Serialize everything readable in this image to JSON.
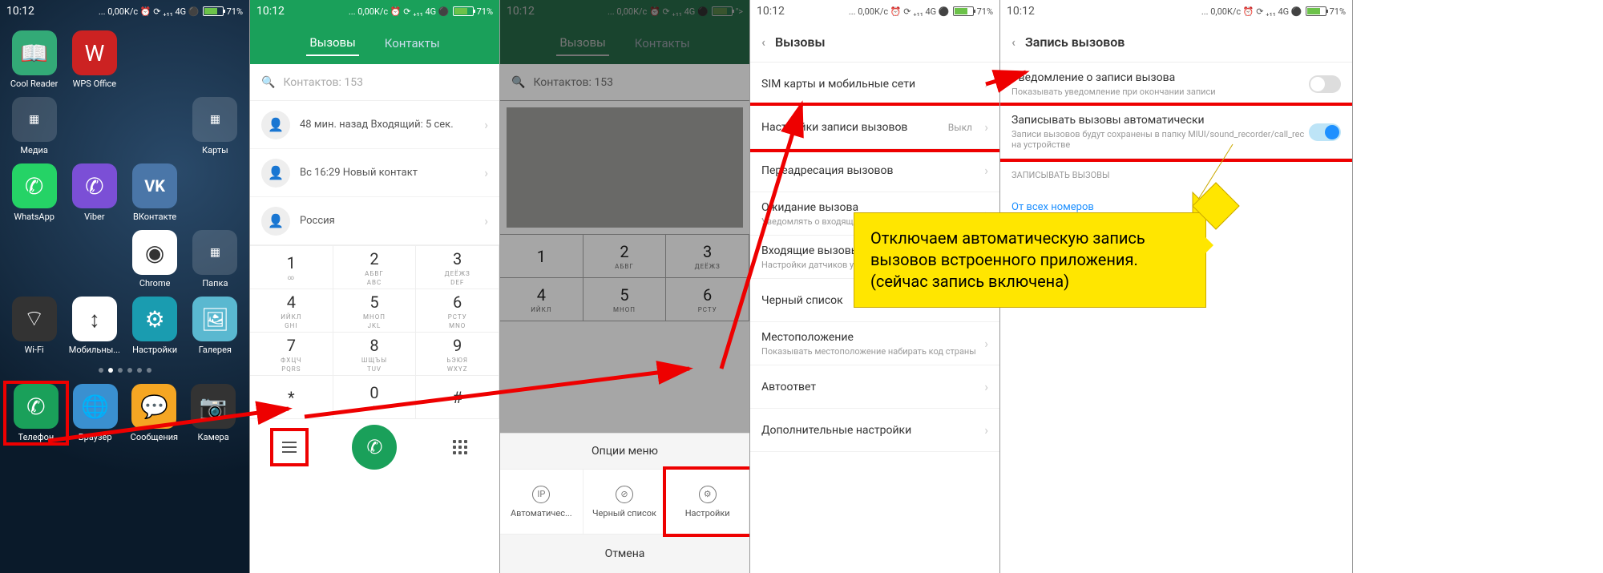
{
  "status": {
    "time": "10:12",
    "net": "...  0,00K/c ⏰ ⟳ ₊₁₁ 4G ⚫",
    "batt": "71%"
  },
  "home": {
    "apps": [
      "Cool Reader",
      "WPS Office",
      "Медиа",
      "Карты",
      "WhatsApp",
      "Viber",
      "ВКонтакте",
      "Chrome",
      "Папка",
      "Wi-Fi",
      "Мобильны...",
      "Настройки",
      "Галерея"
    ],
    "dock": [
      "Телефон",
      "Браузер",
      "Сообщения",
      "Камера"
    ]
  },
  "dialer": {
    "tabs": [
      "Вызовы",
      "Контакты"
    ],
    "search_ph": "Контактов: 153",
    "rows": [
      "48 мин. назад Входящий: 5 сек.",
      "Вс 16:29 Новый контакт",
      "Россия"
    ],
    "keys": [
      [
        "1",
        "∞",
        ""
      ],
      [
        "2",
        "АБВГ",
        "ABC"
      ],
      [
        "3",
        "ДЕЁЖЗ",
        "DEF"
      ],
      [
        "4",
        "ИЙКЛ",
        "GHI"
      ],
      [
        "5",
        "МНОП",
        "JKL"
      ],
      [
        "6",
        "РСТУ",
        "MNO"
      ],
      [
        "7",
        "ФХЦЧ",
        "PQRS"
      ],
      [
        "8",
        "ШЩЪЫ",
        "TUV"
      ],
      [
        "9",
        "ЬЭЮЯ",
        "WXYZ"
      ],
      [
        "*",
        "",
        ""
      ],
      [
        "0",
        "+",
        ""
      ],
      [
        "#",
        "",
        ""
      ]
    ]
  },
  "popup": {
    "title": "Опции меню",
    "opts": [
      "Автоматичес...",
      "Черный список",
      "Настройки"
    ],
    "cancel": "Отмена"
  },
  "set1": {
    "title": "Вызовы",
    "rows": [
      {
        "t": "SIM карты и мобильные сети"
      },
      {
        "t": "Настройки записи вызовов",
        "v": "Выкл"
      },
      {
        "t": "Переадресация вызовов"
      },
      {
        "t": "Ожидание вызова",
        "s": "Уведомлять о входящих вызовах во время разговора"
      },
      {
        "t": "Входящие вызовы",
        "s": "Настройки датчиков у вызове"
      },
      {
        "t": "Черный список"
      },
      {
        "t": "Местоположение",
        "s": "Показывать местоположение набирать код страны"
      },
      {
        "t": "Автоответ"
      },
      {
        "t": "Дополнительные настройки"
      }
    ]
  },
  "set2": {
    "title": "Запись вызовов",
    "row1": {
      "t": "Уведомление о записи вызова",
      "s": "Показывать уведомление при окончании записи"
    },
    "row2": {
      "t": "Записывать вызовы автоматически",
      "s": "Записи вызовов будут сохранены в папку MIUI/sound_recorder/call_rec на устройстве"
    },
    "sect": "ЗАПИСЫВАТЬ ВЫЗОВЫ",
    "link": "От всех номеров"
  },
  "callout": "Отключаем автоматическую запись вызовов встроенного приложения.\n(сейчас запись включена)"
}
